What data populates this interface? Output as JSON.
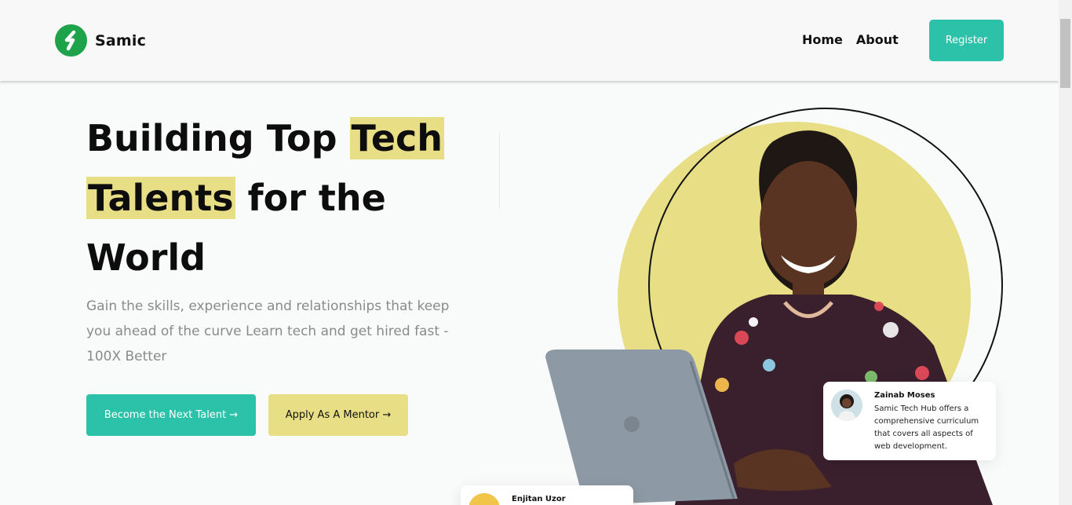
{
  "brand": {
    "name": "Samic",
    "logo_icon": "samic-s-logo",
    "color": "#1fa34a"
  },
  "nav": {
    "links": [
      "Home",
      "About"
    ],
    "register_label": "Register"
  },
  "hero": {
    "title_part1": "Building Top ",
    "title_highlight1": "Tech",
    "title_highlight2": "Talents",
    "title_part2": " for the",
    "title_part3": "World",
    "description": "Gain the skills, experience and relationships that keep you ahead of the curve Learn tech and get hired fast - 100X Better",
    "cta_primary": "Become the Next Talent →",
    "cta_secondary": "Apply As A Mentor →"
  },
  "testimonials": [
    {
      "name": "Zainab Moses",
      "text": "Samic Tech Hub offers a comprehensive curriculum that covers all aspects of web development."
    },
    {
      "name": "Enjitan Uzor"
    }
  ],
  "colors": {
    "accent": "#2cc2a9",
    "highlight": "#e8de86",
    "text_muted": "#8a8a8a"
  }
}
